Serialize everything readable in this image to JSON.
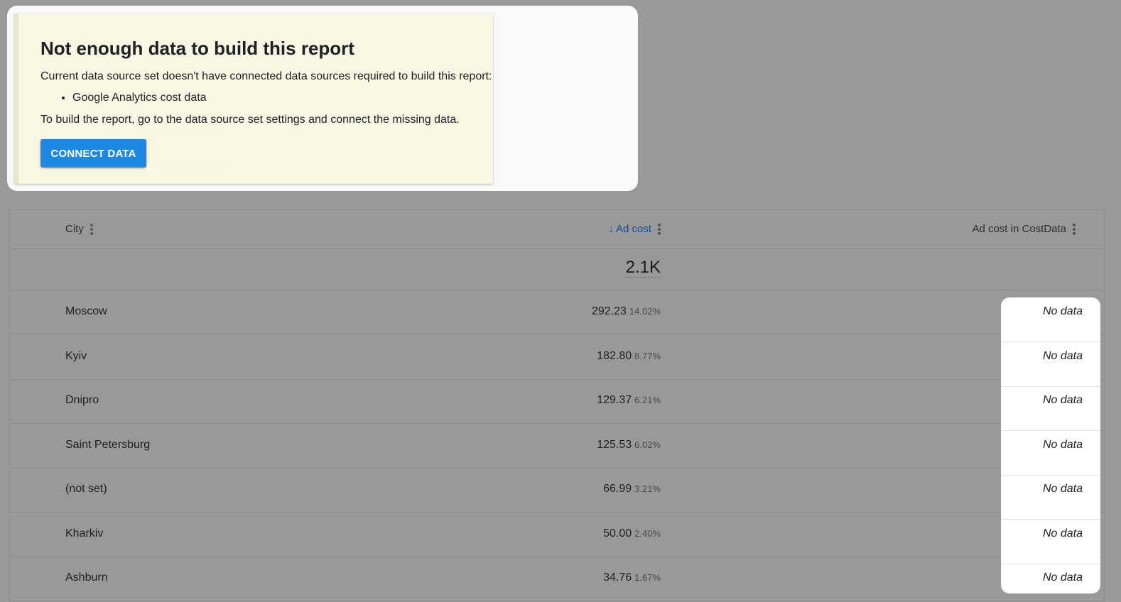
{
  "notice": {
    "title": "Not enough data to build this report",
    "line1": "Current data source set doesn't have connected data sources required to build this report:",
    "missing_sources": [
      "Google Analytics cost data"
    ],
    "line2": "To build the report, go to the data source set settings and connect the missing data.",
    "button_label": "CONNECT DATA"
  },
  "table": {
    "columns": {
      "city": "City",
      "sort_indicator": "↓",
      "ad_cost": "Ad cost",
      "ad_cost_costdata": "Ad cost in CostData"
    },
    "total": "2.1K",
    "rows": [
      {
        "city": "Moscow",
        "cost": "292.23",
        "pct": "14.02%",
        "costdata": "No data"
      },
      {
        "city": "Kyiv",
        "cost": "182.80",
        "pct": "8.77%",
        "costdata": "No data"
      },
      {
        "city": "Dnipro",
        "cost": "129.37",
        "pct": "6.21%",
        "costdata": "No data"
      },
      {
        "city": "Saint Petersburg",
        "cost": "125.53",
        "pct": "6.02%",
        "costdata": "No data"
      },
      {
        "city": "(not set)",
        "cost": "66.99",
        "pct": "3.21%",
        "costdata": "No data"
      },
      {
        "city": "Kharkiv",
        "cost": "50.00",
        "pct": "2.40%",
        "costdata": "No data"
      },
      {
        "city": "Ashburn",
        "cost": "34.76",
        "pct": "1.67%",
        "costdata": "No data"
      }
    ]
  },
  "colors": {
    "overlay": "#999999",
    "notice_bg": "#f7f7e3",
    "button": "#1e88e5",
    "sorted_header": "#0b4fa3"
  },
  "icons": {
    "column_menu": "kebab-menu-icon",
    "sort": "arrow-down-icon"
  }
}
